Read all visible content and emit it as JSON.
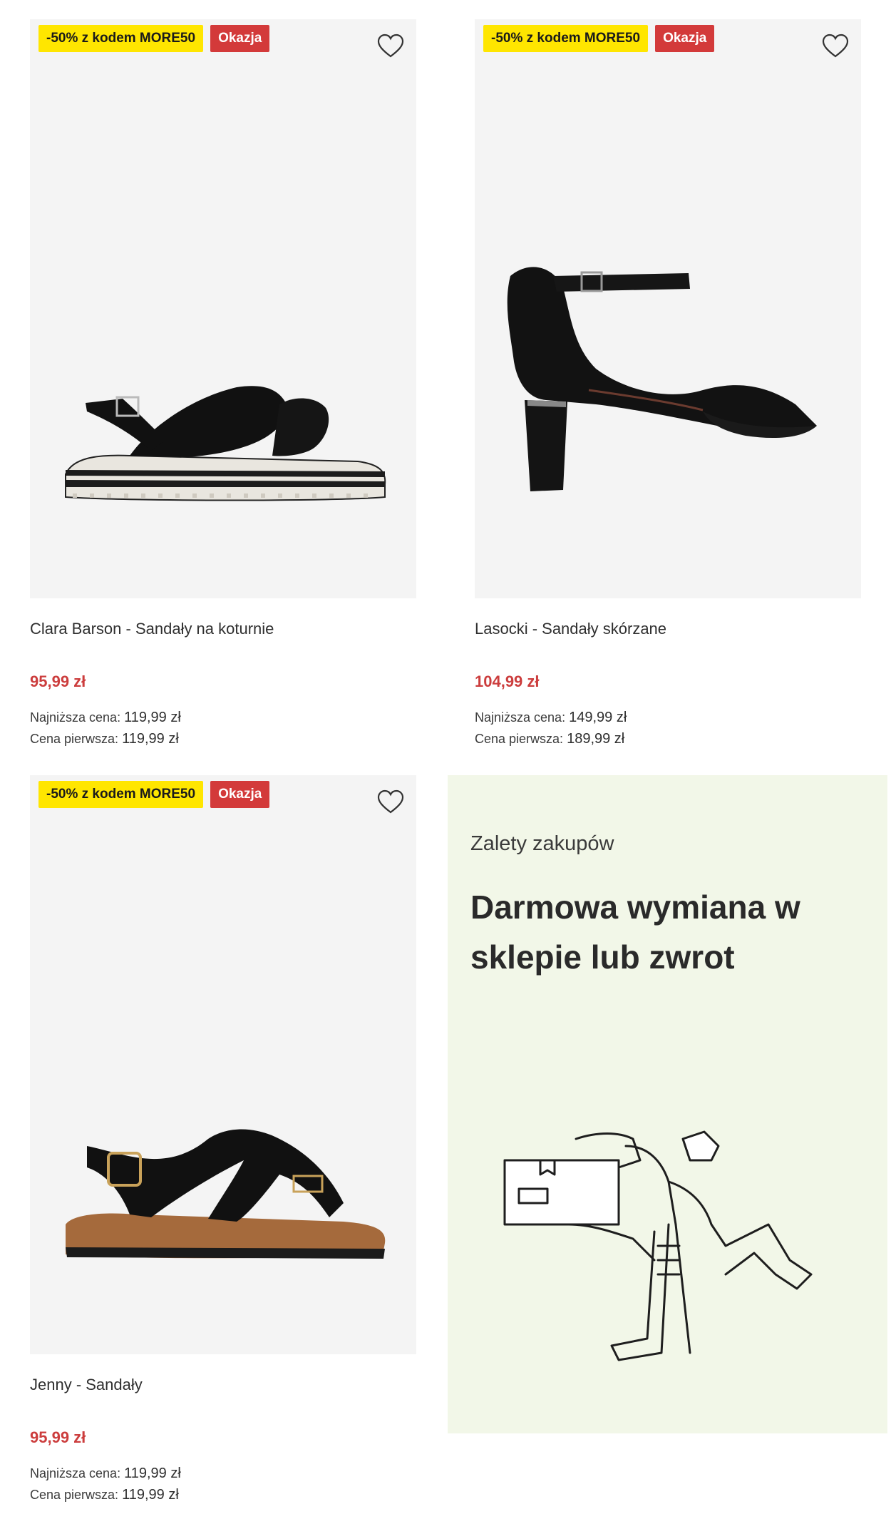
{
  "products": [
    {
      "promo_badge": "-50% z kodem MORE50",
      "deal_badge": "Okazja",
      "name": "Clara Barson - Sandały na koturnie",
      "price": "95,99 zł",
      "lowest_label": "Najniższa cena:",
      "lowest_value": "119,99 zł",
      "first_label": "Cena pierwsza:",
      "first_value": "119,99 zł"
    },
    {
      "promo_badge": "-50% z kodem MORE50",
      "deal_badge": "Okazja",
      "name": "Lasocki - Sandały skórzane",
      "price": "104,99 zł",
      "lowest_label": "Najniższa cena:",
      "lowest_value": "149,99 zł",
      "first_label": "Cena pierwsza:",
      "first_value": "189,99 zł"
    },
    {
      "promo_badge": "-50% z kodem MORE50",
      "deal_badge": "Okazja",
      "name": "Jenny - Sandały",
      "price": "95,99 zł",
      "lowest_label": "Najniższa cena:",
      "lowest_value": "119,99 zł",
      "first_label": "Cena pierwsza:",
      "first_value": "119,99 zł"
    }
  ],
  "banner": {
    "subtitle": "Zalety zakupów",
    "title": "Darmowa wymiana w sklepie lub zwrot"
  },
  "colors": {
    "promo_badge_bg": "#ffe600",
    "deal_badge_bg": "#d33a3a",
    "price": "#cc3d3d",
    "banner_bg": "#f2f7e8",
    "image_bg": "#f4f4f4"
  },
  "icons": [
    "heart-icon",
    "courier-illustration"
  ]
}
